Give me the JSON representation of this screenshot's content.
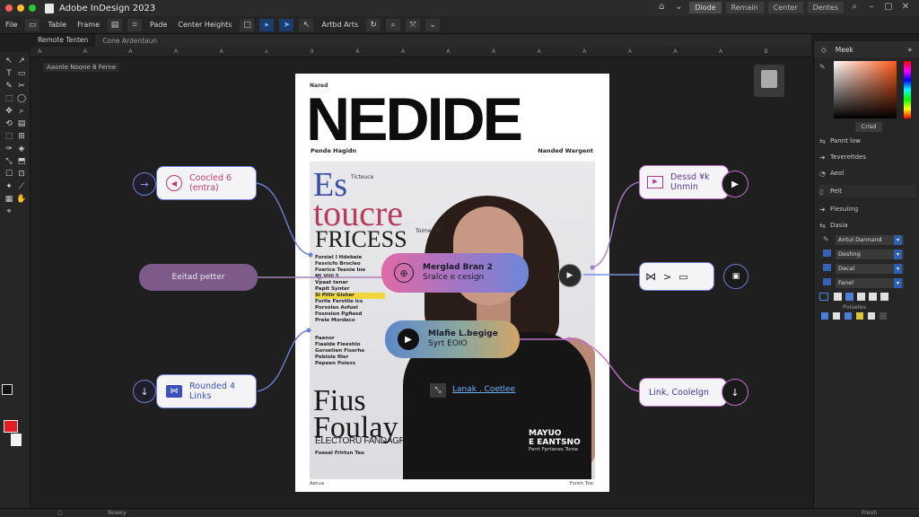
{
  "app": {
    "title": "Adobe InDesign 2023",
    "traffic_colors": [
      "#ff5f57",
      "#febc2e",
      "#28c840"
    ]
  },
  "titlebar_right": {
    "workspaces": [
      "Diode",
      "Remain",
      "Center",
      "Dentes"
    ]
  },
  "menubar": {
    "items": [
      "File",
      "Table",
      "Frame"
    ],
    "controls": [
      "Pade",
      "Center Heights",
      "Artbd Arts"
    ]
  },
  "doc_tabs": [
    "Remote Tenten",
    "Cone Ardentaun"
  ],
  "ruler_ticks": [
    "A",
    "A",
    "A",
    "A",
    "A",
    "a",
    "9",
    "A",
    "A",
    "A",
    "A",
    "A",
    "A",
    "A",
    "A",
    "A",
    "B"
  ],
  "canvas": {
    "path_label": "Aaonle Noone 8 Ferne"
  },
  "magazine": {
    "kicker": "Nared",
    "title": "NEDIDE",
    "sub_left": "Pende Hagidn",
    "sub_right": "Nanded Wargent",
    "es": "Es",
    "es_note": "Ticteuce",
    "toucre": "toucre",
    "fricess": "FRICESS",
    "fricess_note": "Toimes fic",
    "col1": [
      "Forsiel I Hdebaie",
      "Fesvicfo Brocleo",
      "Foerice Teenie Ine",
      "Mi Viiil 5",
      "Vpaat tenar",
      "Papit Synter"
    ],
    "col2": [
      "Sl Pillir Gisher",
      "Forile Ferstlie lcs",
      "Porsoles Asfuel",
      "Fosnsion Pgfiesd",
      "Prele Mordeco"
    ],
    "col3": [
      "Paenor",
      "Fiaalde Fieeshlo",
      "Gorsetien Fiserhe",
      "Pebiole filer",
      "Pepeen Poiess"
    ],
    "fius": "Fius",
    "foulay": "Foulay",
    "electoru": "ELECTORU FANDAGRY",
    "fius_note": "Foesel Frlrtsn Teu",
    "right_note": "MAYUO",
    "right_note2": "E EANTSNO",
    "right_note3": "Ferrt Fprtanes Toroe",
    "foot_left": "Aetua",
    "foot_right": "Foreh Toe"
  },
  "nodes": {
    "coded": {
      "line1": "Coocled 6",
      "line2": "(entra)"
    },
    "edited": {
      "label": "Eeitad petter"
    },
    "rounded": {
      "line1": "Rounded 4",
      "line2": "Links"
    },
    "merged": {
      "line1": "Merglad Bran 2",
      "line2": "Sralce e cesign"
    },
    "media": {
      "line1": "Mlafie L.begige",
      "line2": "Syrt EOIO"
    },
    "link_label": "Lanak . Coetlee",
    "dessed": {
      "line1": "Dessd ¥k",
      "line2": "Unmin"
    },
    "link_coolelgn": {
      "label": "Link, Coolelgn"
    },
    "flow_arrow": ">"
  },
  "right_panel": {
    "tab": "Meek",
    "value_box": "Crisd",
    "items": [
      "Pannt low",
      "Tevereltdes",
      "Aeol",
      "Peit",
      "Flesuiing",
      "Dasia"
    ],
    "selects": [
      "Antul Dannand",
      "Deshng",
      "Dacal",
      "Fanel"
    ],
    "extra": "Poiseles"
  },
  "statusbar": {
    "left": "Noeey",
    "right": "Fresh"
  },
  "colors": {
    "accent_blue": "#2f6fe0",
    "node_border_blue": "#6b7ed8",
    "node_border_pink": "#c070c8",
    "red_swatch": "#e31b23"
  }
}
